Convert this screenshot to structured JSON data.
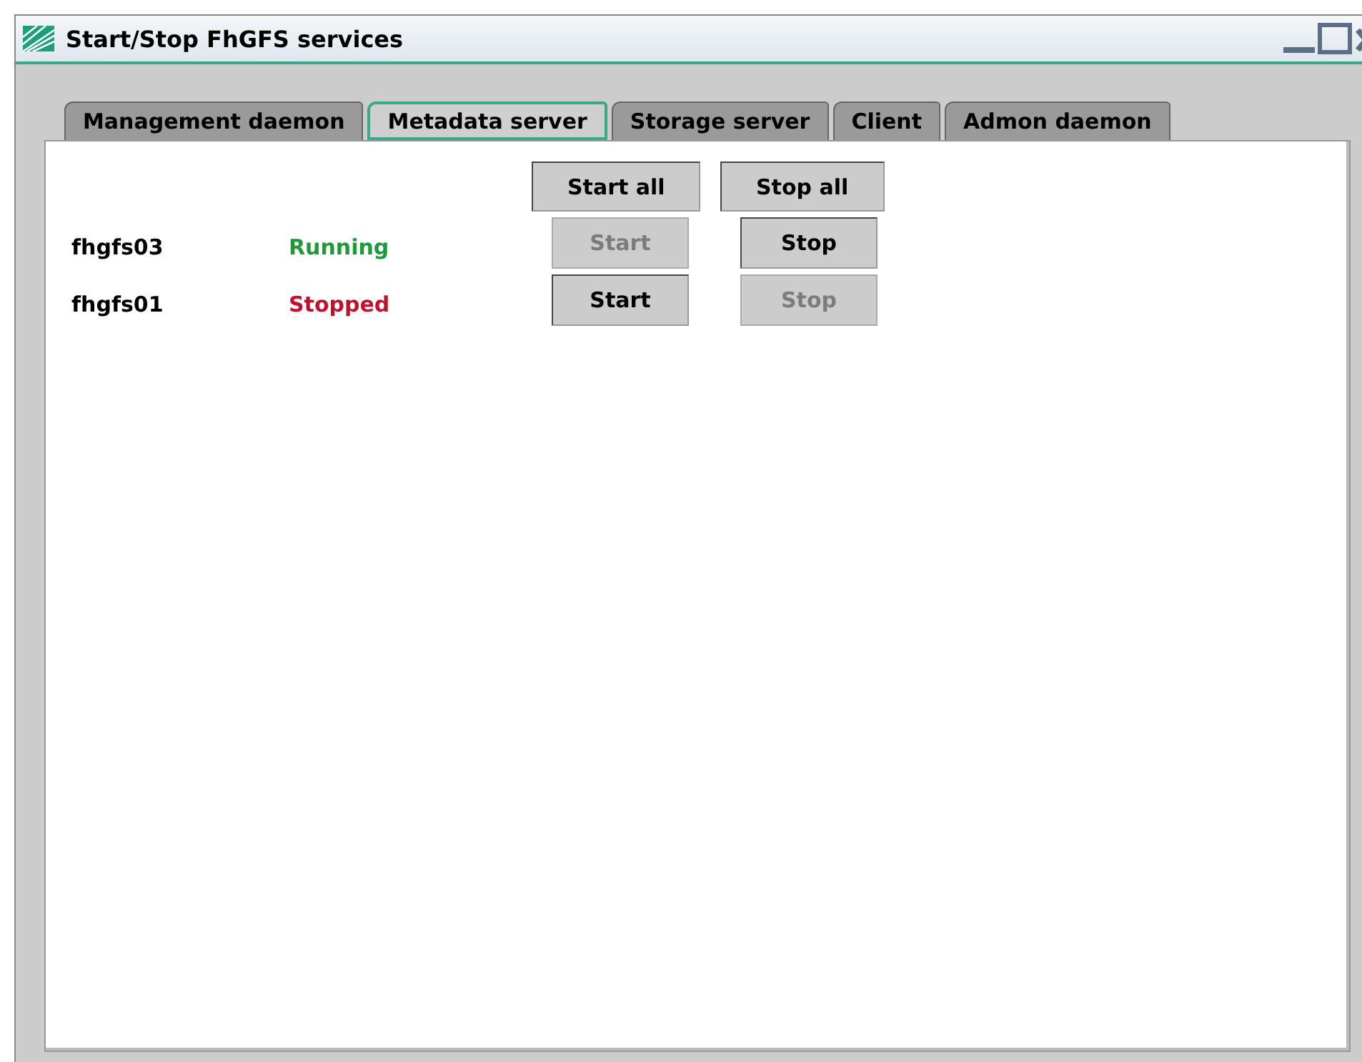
{
  "window": {
    "title": "Start/Stop FhGFS services"
  },
  "tabs": [
    {
      "label": "Management daemon",
      "selected": false
    },
    {
      "label": "Metadata server",
      "selected": true
    },
    {
      "label": "Storage server",
      "selected": false
    },
    {
      "label": "Client",
      "selected": false
    },
    {
      "label": "Admon daemon",
      "selected": false
    }
  ],
  "global_buttons": [
    {
      "label": "Start all",
      "disabled": false
    },
    {
      "label": "Stop all",
      "disabled": false
    }
  ],
  "services": [
    {
      "host": "fhgfs03",
      "status": "Running",
      "kind": "running",
      "start": {
        "label": "Start",
        "disabled": true
      },
      "stop": {
        "label": "Stop",
        "disabled": false
      }
    },
    {
      "host": "fhgfs01",
      "status": "Stopped",
      "kind": "stopped",
      "start": {
        "label": "Start",
        "disabled": false
      },
      "stop": {
        "label": "Stop",
        "disabled": true
      }
    }
  ]
}
